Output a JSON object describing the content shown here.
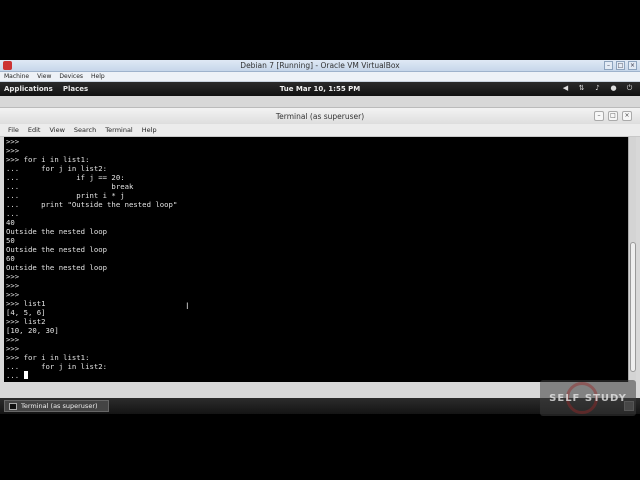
{
  "vbox": {
    "title": "Debian 7 [Running] - Oracle VM VirtualBox",
    "menu": [
      "Machine",
      "View",
      "Devices",
      "Help"
    ]
  },
  "panel": {
    "applications": "Applications",
    "places": "Places",
    "clock": "Tue Mar 10,  1:55 PM",
    "tray_icons": [
      "speaker-icon",
      "network-icon",
      "volume-icon",
      "user-icon",
      "power-icon"
    ]
  },
  "terminal": {
    "title": "Terminal (as superuser)",
    "menu": [
      "File",
      "Edit",
      "View",
      "Search",
      "Terminal",
      "Help"
    ],
    "lines": [
      ">>>",
      ">>>",
      ">>> for i in list1:",
      "...     for j in list2:",
      "...             if j == 20:",
      "...                     break",
      "...             print i * j",
      "...     print \"Outside the nested loop\"",
      "...",
      "40",
      "Outside the nested loop",
      "50",
      "Outside the nested loop",
      "60",
      "Outside the nested loop",
      ">>>",
      ">>>",
      ">>>",
      ">>> list1",
      "[4, 5, 6]",
      ">>> list2",
      "[10, 20, 30]",
      ">>>",
      ">>>",
      ">>> for i in list1:",
      "...     for j in list2:",
      "... "
    ]
  },
  "taskbar": {
    "window_label": "Terminal (as superuser)"
  },
  "watermark": {
    "text": "SELF STUDY"
  }
}
